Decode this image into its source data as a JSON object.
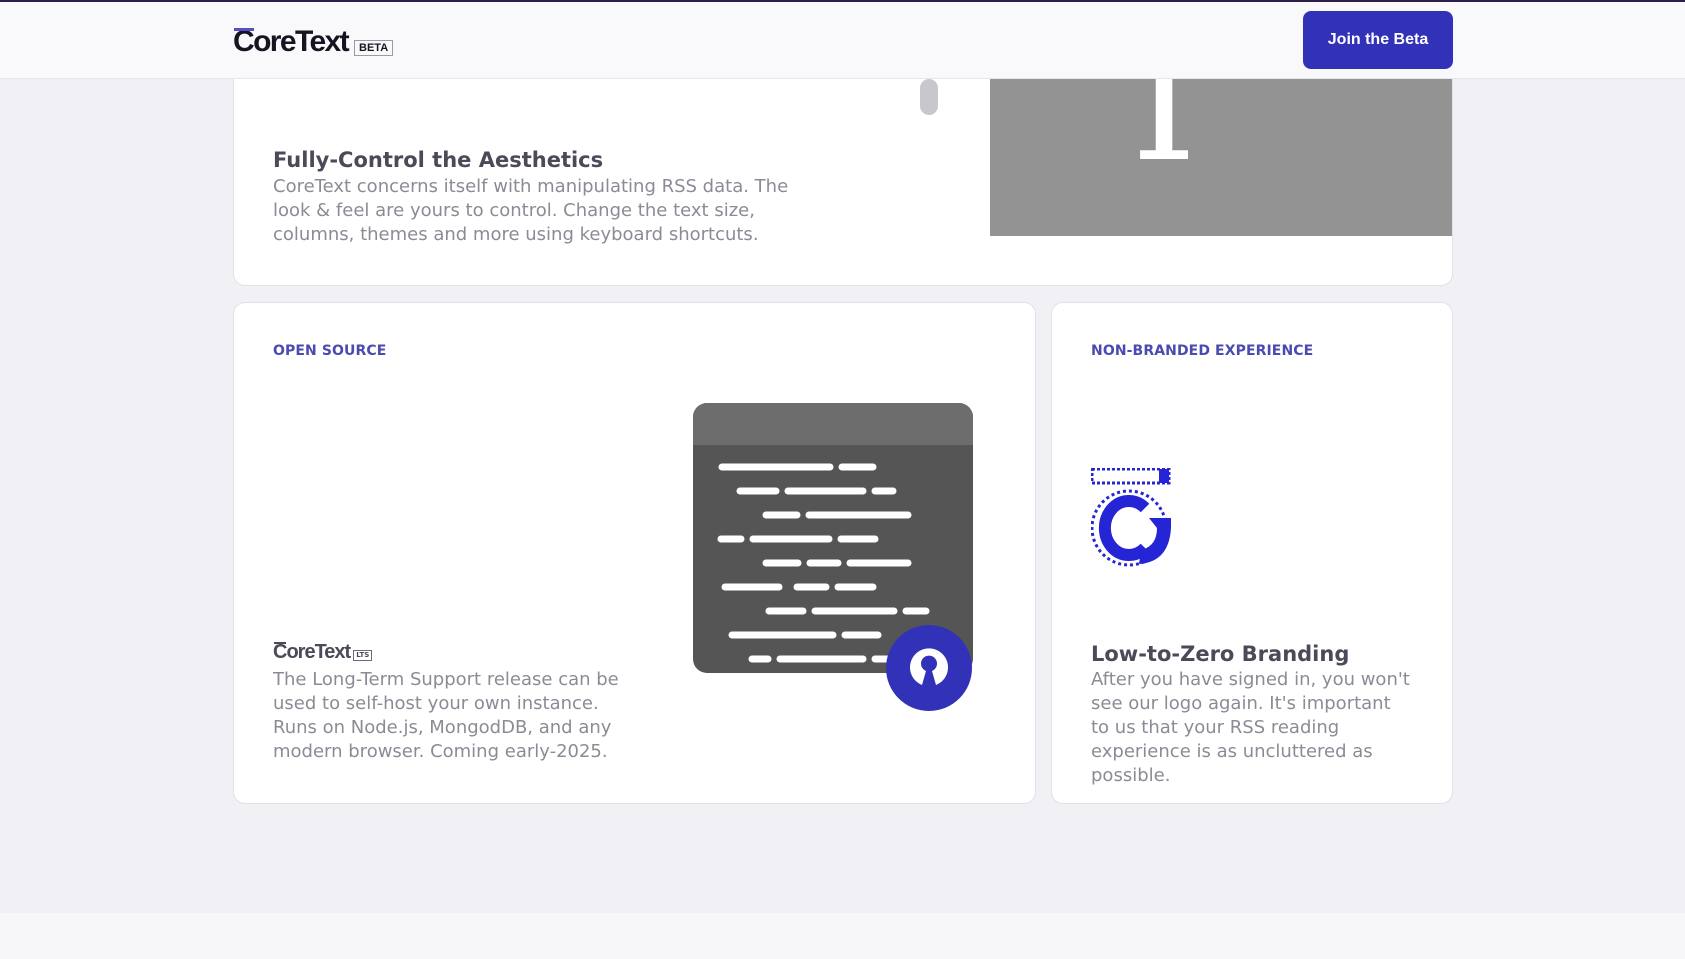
{
  "header": {
    "logo_text": "CoreText",
    "logo_badge": "BETA",
    "cta_label": "Join the Beta"
  },
  "aesthetics": {
    "mock_glyph": "T",
    "title": "Fully-Control the Aesthetics",
    "description": "CoreText concerns itself with manipulating RSS data. The look & feel are yours to control. Change the text size, columns, themes and more using keyboard shortcuts."
  },
  "open_source": {
    "eyebrow": "OPEN SOURCE",
    "logo_text": "CoreText",
    "logo_badge": "LTS",
    "description": "The Long-Term Support release can be used to self-host your own instance. Runs on Node.js, MongodDB, and any modern browser. Coming early-2025."
  },
  "non_branded": {
    "eyebrow": "NON-BRANDED EXPERIENCE",
    "title": "Low-to-Zero Branding",
    "description": "After you have signed in, you won't see our logo again. It's important to us that your RSS reading experience is as uncluttered as possible."
  },
  "icons": [
    "open-source-icon",
    "coretext-monogram-icon"
  ],
  "colors": {
    "accent": "#3232b8",
    "eyebrow": "#4a4ab0",
    "mock_gray": "#939393",
    "terminal": "#555556"
  }
}
